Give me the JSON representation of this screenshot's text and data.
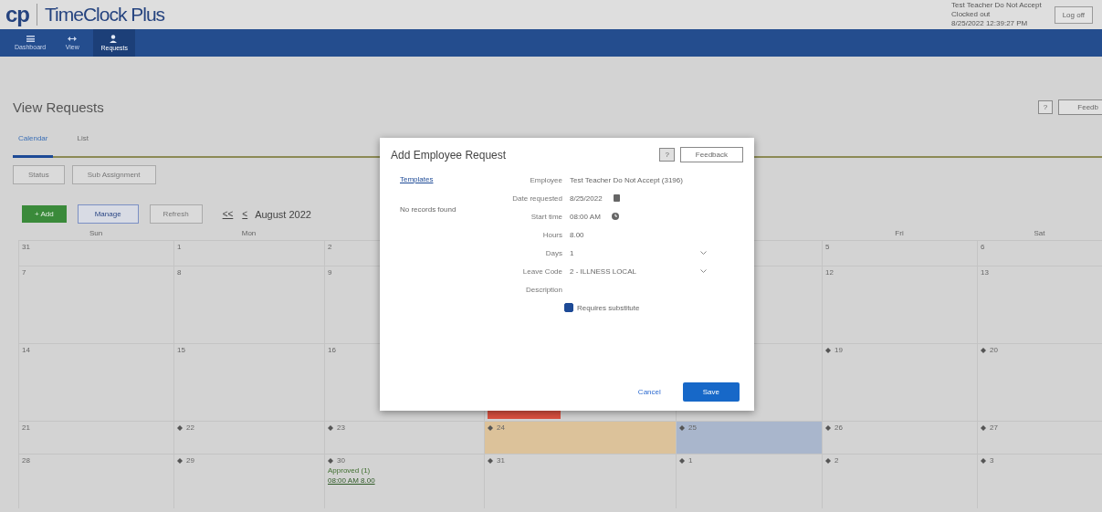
{
  "header": {
    "logo_mark": "cp",
    "logo_text": "TimeClock Plus",
    "user": "Test Teacher Do Not Accept",
    "status": "Clocked out",
    "datetime": "8/25/2022 12:39:27 PM",
    "logoff": "Log off"
  },
  "nav": [
    {
      "label": "Dashboard",
      "selected": false
    },
    {
      "label": "View",
      "selected": false
    },
    {
      "label": "Requests",
      "selected": true
    }
  ],
  "page": {
    "title": "View Requests",
    "help": "?",
    "feedback": "Feedb"
  },
  "tabs": [
    {
      "label": "Calendar",
      "selected": true
    },
    {
      "label": "List",
      "selected": false
    }
  ],
  "filters": [
    "Status",
    "Sub Assignment"
  ],
  "toolbar": {
    "add": "+ Add",
    "manage": "Manage",
    "refresh": "Refresh",
    "prev_month": "<<",
    "prev": "<",
    "month": "August 2022"
  },
  "calendar": {
    "weekdays": {
      "sun": "Sun",
      "mon": "Mon",
      "fri": "Fri",
      "sat": "Sat"
    },
    "weeks": [
      {
        "sun": {
          "day": "31",
          "marker": false
        },
        "mon": {
          "day": "1",
          "marker": false
        },
        "tue": {
          "day": "2",
          "marker": false
        },
        "fri": {
          "day": "5",
          "marker": false
        },
        "sat": {
          "day": "6",
          "marker": false
        }
      },
      {
        "sun": {
          "day": "7",
          "marker": false
        },
        "mon": {
          "day": "8",
          "marker": false
        },
        "tue": {
          "day": "9",
          "marker": false
        },
        "fri": {
          "day": "12",
          "marker": false
        },
        "sat": {
          "day": "13",
          "marker": false
        }
      },
      {
        "sun": {
          "day": "14",
          "marker": false
        },
        "mon": {
          "day": "15",
          "marker": false
        },
        "tue": {
          "day": "16",
          "marker": false
        },
        "wed": {
          "badge": {
            "color": "#d9503f"
          }
        },
        "fri": {
          "day": "19",
          "marker": true
        },
        "sat": {
          "day": "20",
          "marker": true
        }
      },
      {
        "sun": {
          "day": "21",
          "marker": false
        },
        "mon": {
          "day": "22",
          "marker": true
        },
        "tue": {
          "day": "23",
          "marker": true
        },
        "wed": {
          "day": "24",
          "marker": true,
          "color": "#dcc29a"
        },
        "thu": {
          "day": "25",
          "marker": true,
          "color": "#a9b6cc"
        },
        "fri": {
          "day": "26",
          "marker": true
        },
        "sat": {
          "day": "27",
          "marker": true
        }
      },
      {
        "sun": {
          "day": "28",
          "marker": false
        },
        "mon": {
          "day": "29",
          "marker": true
        },
        "tue": {
          "day": "30",
          "marker": true,
          "events": [
            {
              "status": "Approved (1)",
              "time": "08:00 AM 8.00"
            }
          ]
        },
        "wed": {
          "day": "31",
          "marker": true
        },
        "thu": {
          "day": "1",
          "marker": true
        },
        "fri": {
          "day": "2",
          "marker": true
        },
        "sat": {
          "day": "3",
          "marker": true
        }
      }
    ]
  },
  "modal": {
    "title": "Add Employee Request",
    "help": "?",
    "feedback": "Feedback",
    "templates": "Templates",
    "empty": "No records found",
    "fields": [
      {
        "kind": "text",
        "label": "Employee",
        "value": "Test Teacher Do Not Accept (3196)"
      },
      {
        "kind": "date",
        "label": "Date requested",
        "value": "8/25/2022"
      },
      {
        "kind": "time",
        "label": "Start time",
        "value": "08:00 AM"
      },
      {
        "kind": "text",
        "label": "Hours",
        "value": "8.00"
      },
      {
        "kind": "select",
        "label": "Days",
        "value": "1"
      },
      {
        "kind": "select",
        "label": "Leave Code",
        "value": "2 - ILLNESS LOCAL"
      },
      {
        "kind": "textarea",
        "label": "Description"
      }
    ],
    "checkbox": {
      "label": "Requires substitute",
      "checked": true
    },
    "cancel": "Cancel",
    "save": "Save"
  }
}
